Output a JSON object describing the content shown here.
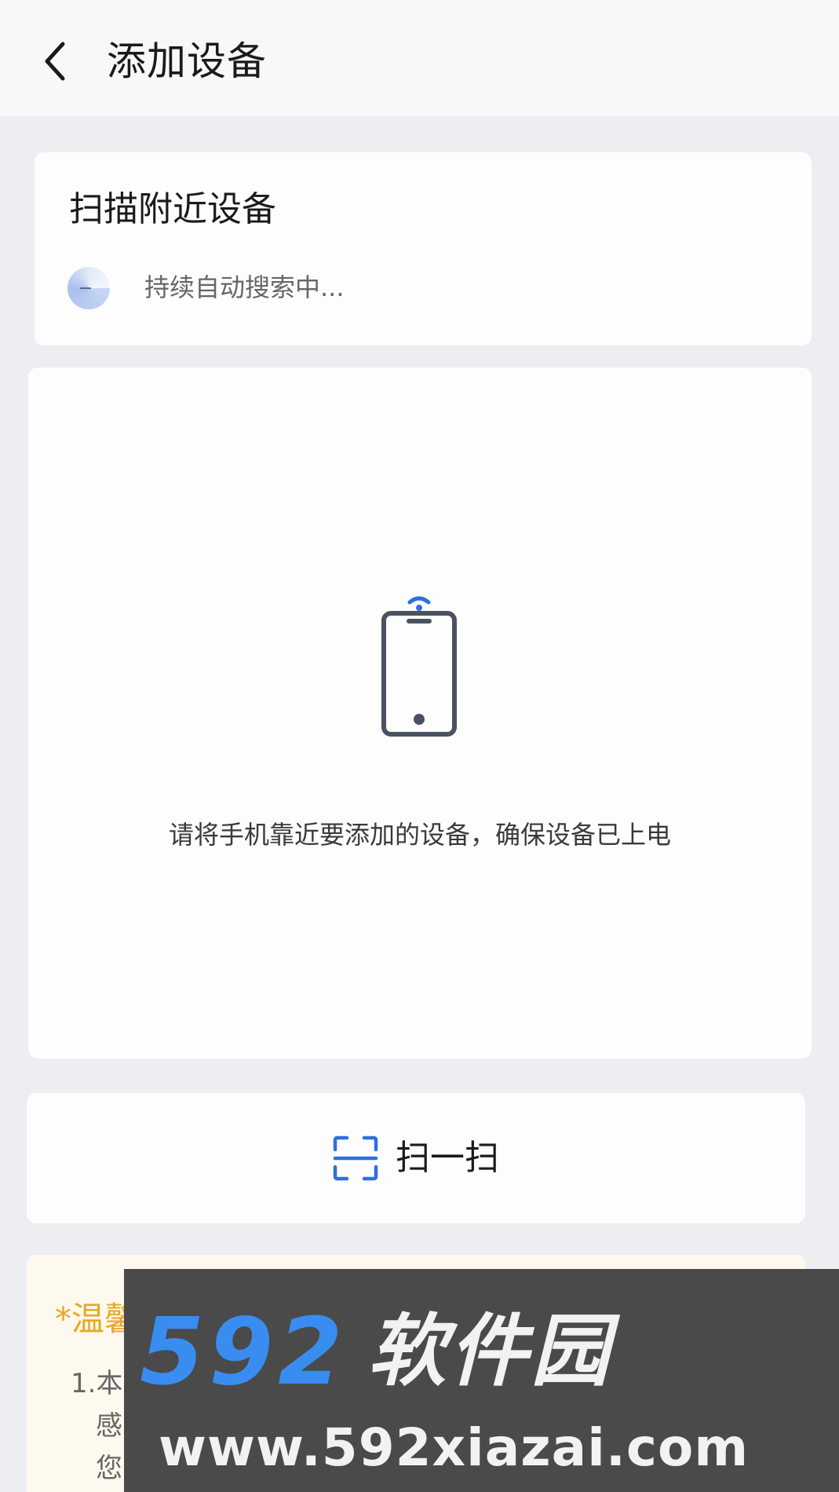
{
  "header": {
    "back_icon": "chevron-left-icon",
    "title": "添加设备"
  },
  "scan_nearby": {
    "title": "扫描附近设备",
    "status": "持续自动搜索中..."
  },
  "device_panel": {
    "illustration": "phone-wireless-icon",
    "hint": "请将手机靠近要添加的设备，确保设备已上电"
  },
  "qr_scan": {
    "icon": "scan-frame-icon",
    "label": "扫一扫"
  },
  "tips": {
    "title": "*温馨",
    "items": [
      "1.本",
      "感",
      "您"
    ]
  },
  "watermark": {
    "brand_number": "592",
    "brand_name": "软件园",
    "url": "www.592xiazai.com"
  },
  "colors": {
    "accent": "#2f6fe0",
    "tips_title": "#e9a825",
    "background": "#ededf2",
    "card": "#fdfdfe"
  }
}
